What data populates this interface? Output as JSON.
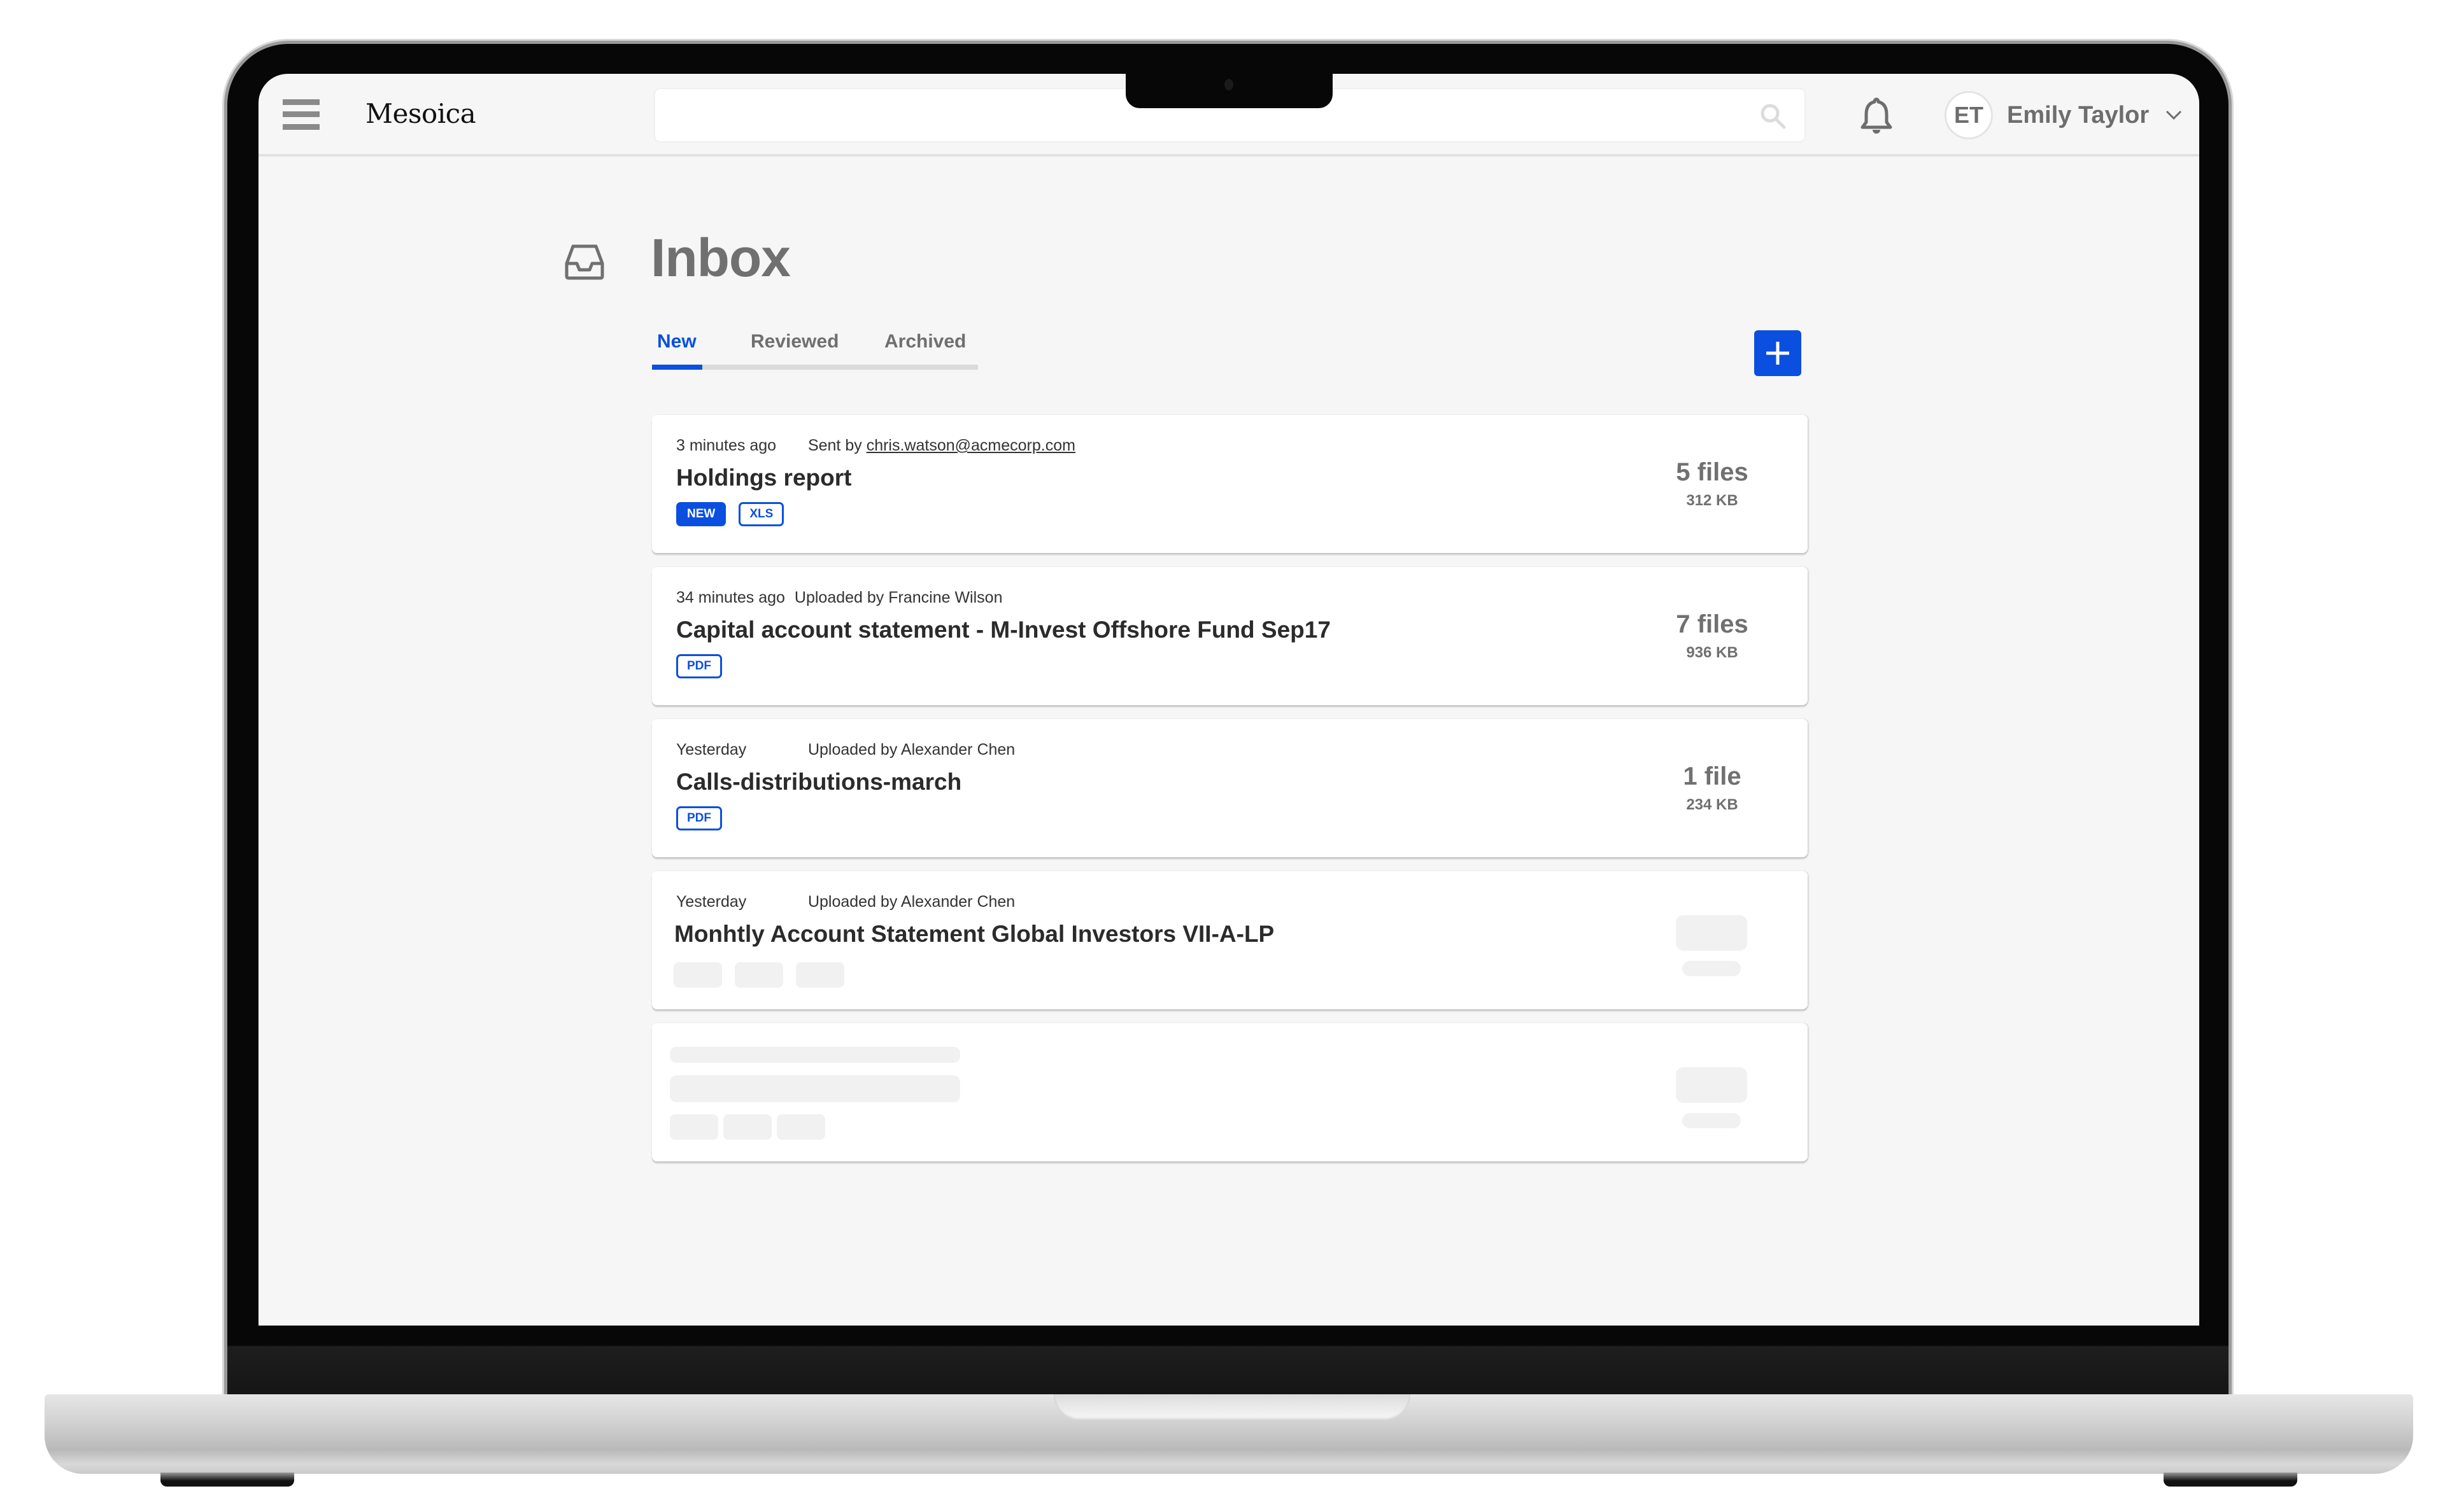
{
  "app": {
    "name": "Mesoica",
    "search": {
      "placeholder": "",
      "value": ""
    },
    "user": {
      "initials": "ET",
      "name": "Emily Taylor"
    }
  },
  "icons": {
    "menu": "hamburger-icon",
    "search": "search-icon",
    "notifications": "bell-icon",
    "user_menu": "chevron-down-icon",
    "page": "inbox-tray-icon",
    "add": "plus-icon"
  },
  "colors": {
    "accent": "#0a4fe0",
    "text_muted": "#707070",
    "background": "#f6f6f6",
    "card": "#ffffff",
    "skeleton": "#f1f1f1"
  },
  "page": {
    "title": "Inbox",
    "tabs": [
      {
        "label": "New",
        "active": true
      },
      {
        "label": "Reviewed",
        "active": false
      },
      {
        "label": "Archived",
        "active": false
      }
    ],
    "add_button_label": "+"
  },
  "items": [
    {
      "time": "3 minutes ago",
      "sender_prefix": "Sent by",
      "sender": "chris.watson@acmecorp.com",
      "title": "Holdings report",
      "badges": [
        "NEW",
        "XLS"
      ],
      "files": "5 files",
      "size": "312 KB"
    },
    {
      "time": "34 minutes ago",
      "sender_prefix": "Uploaded by",
      "sender": "Francine Wilson",
      "title": "Capital account statement - M-Invest Offshore Fund Sep17",
      "badges": [
        "PDF"
      ],
      "files": "7 files",
      "size": "936 KB"
    },
    {
      "time": "Yesterday",
      "sender_prefix": "Uploaded by",
      "sender": "Alexander Chen",
      "title": "Calls-distributions-march",
      "badges": [
        "PDF"
      ],
      "files": "1 file",
      "size": "234 KB"
    },
    {
      "time": "Yesterday",
      "sender_prefix": "Uploaded by",
      "sender": "Alexander Chen",
      "title": "Monhtly Account Statement Global Investors VII-A-LP",
      "status": "loading"
    },
    {
      "status": "loading"
    }
  ]
}
